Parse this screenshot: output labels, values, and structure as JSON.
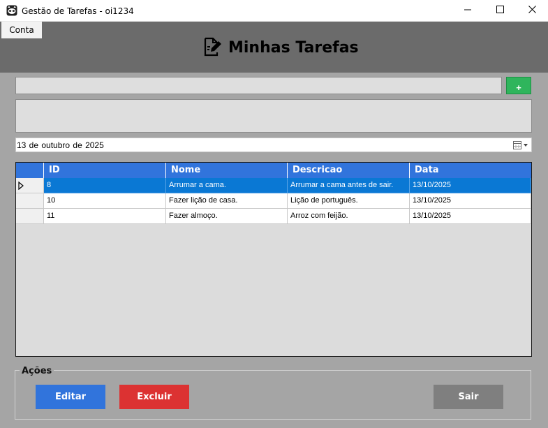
{
  "window": {
    "title": "Gestão de Tarefas - oi1234"
  },
  "menu": {
    "conta": "Conta"
  },
  "header": {
    "title": "Minhas Tarefas"
  },
  "form": {
    "title_value": "",
    "description_value": "",
    "add_label": "+",
    "date_value": "13 de  outubro  de 2025"
  },
  "grid": {
    "columns": [
      "ID",
      "Nome",
      "Descricao",
      "Data"
    ],
    "rows": [
      {
        "id": "8",
        "nome": "Arrumar a cama.",
        "descricao": "Arrumar a cama antes de sair.",
        "data": "13/10/2025",
        "selected": true
      },
      {
        "id": "10",
        "nome": "Fazer lição de casa.",
        "descricao": "Lição de português.",
        "data": "13/10/2025",
        "selected": false
      },
      {
        "id": "11",
        "nome": "Fazer almoço.",
        "descricao": "Arroz com feijão.",
        "data": "13/10/2025",
        "selected": false
      }
    ]
  },
  "actions": {
    "group_label": "Ações",
    "editar": "Editar",
    "excluir": "Excluir",
    "sair": "Sair"
  },
  "colors": {
    "header_band": "#6b6b6b",
    "background": "#a5a5a5",
    "grid_header": "#3174dc",
    "selected_row": "#0a78d4",
    "editar": "#3174dc",
    "excluir": "#dc3232",
    "sair": "#7f7f7f",
    "add": "#2fb55c"
  }
}
